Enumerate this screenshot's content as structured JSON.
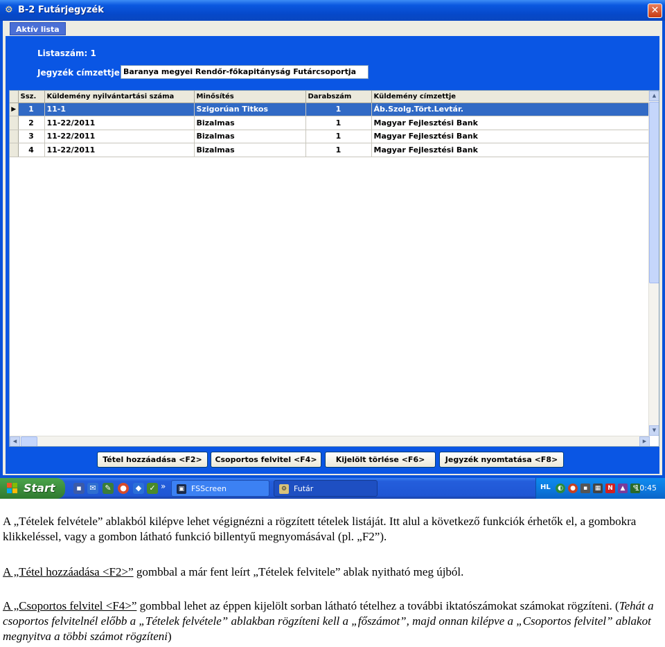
{
  "window": {
    "title": "B-2 Futárjegyzék",
    "close_glyph": "✕",
    "tab_label": "Aktív lista",
    "list_number_label": "Listaszám: 1",
    "recipient_label": "Jegyzék címzettje:",
    "recipient_value": "Baranya megyei Rendőr-főkapitányság Futárcsoportja"
  },
  "grid": {
    "columns": [
      "Ssz.",
      "Küldemény nyilvántartási száma",
      "Minősítés",
      "Darabszám",
      "Küldemény címzettje"
    ],
    "current_row_marker": "▶",
    "rows": [
      {
        "ssz": "1",
        "number": "11-1",
        "classification": "Szigorúan Titkos",
        "count": "1",
        "recipient": "Áb.Szolg.Tört.Levtár."
      },
      {
        "ssz": "2",
        "number": "11-22/2011",
        "classification": "Bizalmas",
        "count": "1",
        "recipient": "Magyar Fejlesztési Bank"
      },
      {
        "ssz": "3",
        "number": "11-22/2011",
        "classification": "Bizalmas",
        "count": "1",
        "recipient": "Magyar Fejlesztési Bank"
      },
      {
        "ssz": "4",
        "number": "11-22/2011",
        "classification": "Bizalmas",
        "count": "1",
        "recipient": "Magyar Fejlesztési Bank"
      }
    ]
  },
  "buttons": {
    "add_item": "Tétel hozzáadása <F2>",
    "group_entry": "Csoportos felvitel <F4>",
    "delete_selected": "Kijelölt törlése <F6>",
    "print_list": "Jegyzék nyomtatása <F8>"
  },
  "taskbar": {
    "start_label": "Start",
    "chevron": "»",
    "tasks": [
      "FSScreen",
      "Futár"
    ],
    "language": "HL",
    "clock": "10:45"
  },
  "document": {
    "paragraph1": "A „Tételek felvétele” ablakból kilépve lehet végignézni a rögzített tételek listáját. Itt alul a következő funkciók érhetők el, a gombokra klikkeléssel, vagy a gombon látható funkció billentyű megnyomásával (pl. „F2”).",
    "p2_link": "A „Tétel hozzáadása <F2>”",
    "p2_rest": " gombbal a már fent leírt „Tételek felvitele” ablak nyitható meg újból.",
    "p3_link": "A „Csoportos felvitel <F4>”",
    "p3_rest": " gombbal lehet az éppen kijelölt sorban látható tételhez a további iktatószámokat számokat rögzíteni. (",
    "p3_italic": "Tehát a csoportos felvitelnél előbb a „Tételek felvétele” ablakban rögzíteni kell a „főszámot”, majd onnan kilépve a „Csoportos felvitel” ablakot megnyitva a többi számot rögzíteni",
    "p3_end": ")"
  },
  "colors": {
    "window_blue": "#0a56e4",
    "selection": "#316ac5",
    "taskbar": "#245edc",
    "start_green": "#3a8a3a"
  }
}
